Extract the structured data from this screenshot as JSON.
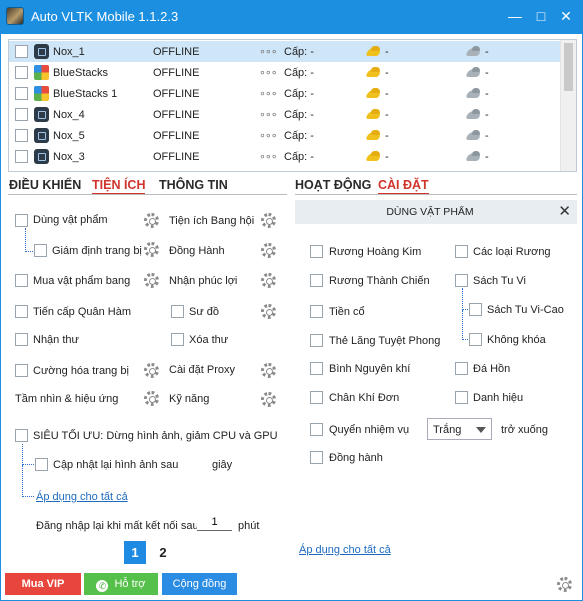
{
  "window": {
    "title": "Auto VLTK Mobile 1.1.2.3",
    "controls": [
      "—",
      "□",
      "✕"
    ]
  },
  "devices": [
    {
      "name": "Nox_1",
      "status": "OFFLINE",
      "level": "Cấp: -",
      "gold": "-",
      "silver": "-",
      "icon": "nox-icon",
      "selected": true
    },
    {
      "name": "BlueStacks",
      "status": "OFFLINE",
      "level": "Cấp: -",
      "gold": "-",
      "silver": "-",
      "icon": "bluestacks-icon"
    },
    {
      "name": "BlueStacks 1",
      "status": "OFFLINE",
      "level": "Cấp: -",
      "gold": "-",
      "silver": "-",
      "icon": "bluestacks-icon"
    },
    {
      "name": "Nox_4",
      "status": "OFFLINE",
      "level": "Cấp: -",
      "gold": "-",
      "silver": "-",
      "icon": "nox-icon"
    },
    {
      "name": "Nox_5",
      "status": "OFFLINE",
      "level": "Cấp: -",
      "gold": "-",
      "silver": "-",
      "icon": "nox-icon"
    },
    {
      "name": "Nox_3",
      "status": "OFFLINE",
      "level": "Cấp: -",
      "gold": "-",
      "silver": "-",
      "icon": "nox-icon"
    }
  ],
  "more_dots": "∘∘∘",
  "left_tabs": [
    "ĐIỀU KHIỂN",
    "TIỆN ÍCH",
    "THÔNG TIN"
  ],
  "right_tabs": [
    "HOẠT ĐỘNG",
    "CÀI ĐẶT"
  ],
  "utilities": {
    "left": {
      "dung_vat_pham": "Dùng vật phẩm",
      "giam_dinh": "Giám định trang bị",
      "mua_vat_pham_bang": "Mua vật phẩm bang",
      "tien_cap": "Tiến cấp Quân Hàm",
      "nhan_thu": "Nhận thư",
      "cuong_hoa": "Cường hóa trang bị",
      "tam_nhin": "Tầm nhìn & hiệu ứng"
    },
    "right": {
      "tien_ich_bang_hoi": "Tiện ích Bang hội",
      "dong_hanh": "Đồng Hành",
      "nhan_phuc_loi": "Nhận phúc lợi",
      "su_do": "Sư đồ",
      "xoa_thu": "Xóa thư",
      "cai_dat_proxy": "Cài đặt Proxy",
      "ky_nang": "Kỹ năng"
    },
    "sieu_toi_uu": "SIÊU TỐI ƯU: Dừng hình ảnh, giảm CPU và GPU",
    "cap_nhat_hinh": "Cập nhật lại hình ảnh sau",
    "giay": "giây",
    "ap_dung": "Áp dụng cho tất cả",
    "dang_nhap_lai": "Đăng nhập lại khi mất kết nối sau",
    "reconnect_minutes": "1",
    "phut": "phút",
    "pages": [
      "1",
      "2"
    ],
    "active_page": "1"
  },
  "item_panel": {
    "title": "DÙNG VẬT PHẨM",
    "close": "✕",
    "left_items": [
      "Rương Hoàng Kim",
      "Rương Thành Chiến",
      "Tiền cổ",
      "Thẻ Lăng Tuyệt Phong",
      "Bình Nguyên khí",
      "Chân Khí Đơn"
    ],
    "right_items": [
      "Các loại Rương",
      "Sách Tu Vi",
      "Sách Tu Vi-Cao",
      "Không khóa",
      "Đá Hồn",
      "Danh hiệu"
    ],
    "quyen_nhiem_vu": "Quyển nhiệm vụ",
    "quality_select": "Trắng",
    "tro_xuong": "trở xuống",
    "dong_hanh": "Đồng hành",
    "ap_dung": "Áp dụng cho tất cả"
  },
  "bottom_bar": {
    "vip": "Mua VIP",
    "support": "Hỗ trợ",
    "community": "Cộng đồng"
  },
  "colors": {
    "titlebar": "#1c8fe0",
    "active_tab": "#d0342c",
    "vip": "#e8453c",
    "support": "#56c14a",
    "community": "#2b8ce3",
    "link": "#1e6bbf"
  }
}
